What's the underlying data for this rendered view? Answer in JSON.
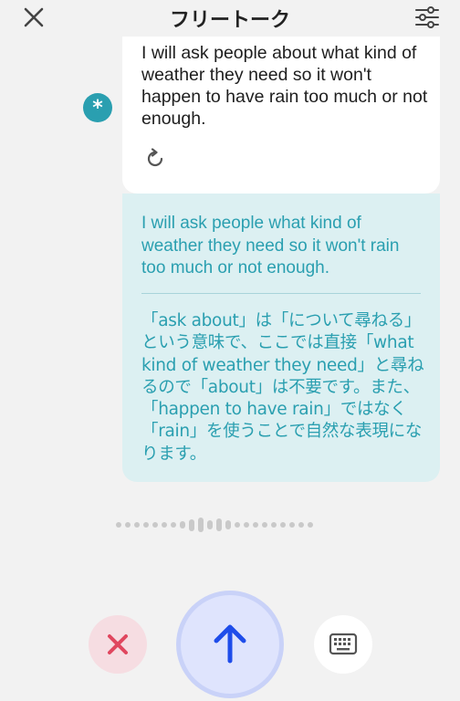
{
  "header": {
    "title": "フリートーク"
  },
  "ai_message": {
    "avatar_glyph": "*",
    "text": "I will ask people about what kind of weather they need so it won't happen to have rain too much or not enough."
  },
  "correction": {
    "corrected_text": "I will ask people what kind of weather they need so it won't rain too much or not enough.",
    "explanation": "「ask about」は「について尋ねる」という意味で、ここでは直接「what kind of weather they need」と尋ねるので「about」は不要です。また、「happen to have rain」ではなく「rain」を使うことで自然な表現になります。"
  },
  "waveform": {
    "levels": [
      0.3,
      0.3,
      0.3,
      0.3,
      0.3,
      0.3,
      0.3,
      0.5,
      0.8,
      1.0,
      0.6,
      0.9,
      0.6,
      0.4,
      0.3,
      0.3,
      0.3,
      0.3,
      0.3,
      0.3,
      0.3,
      0.3
    ]
  },
  "colors": {
    "accent": "#2a9fb0",
    "send": "#1f4dea",
    "cancel": "#e0475f"
  }
}
